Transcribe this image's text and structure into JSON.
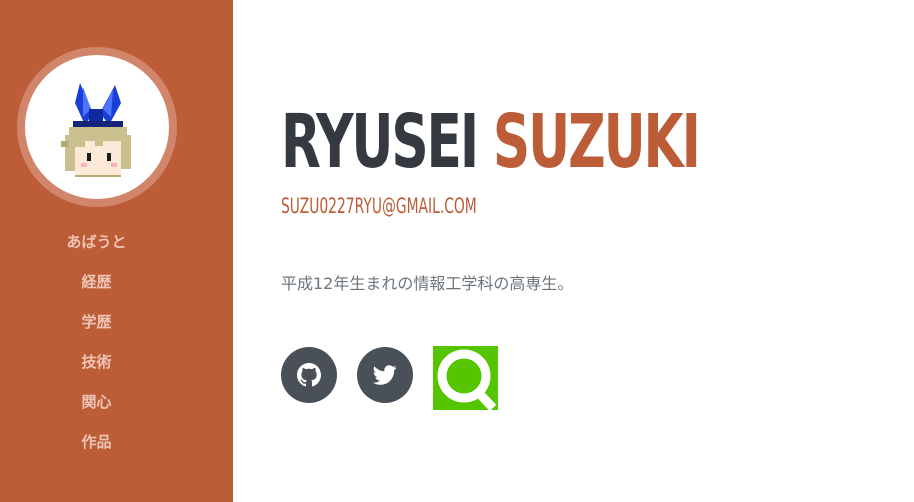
{
  "sidebar": {
    "background": "#bd5d38",
    "nav_items": [
      {
        "label": "あばうと"
      },
      {
        "label": "経歴"
      },
      {
        "label": "学歴"
      },
      {
        "label": "技術"
      },
      {
        "label": "関心"
      },
      {
        "label": "作品"
      }
    ]
  },
  "profile": {
    "first_name": "RYUSEI",
    "last_name": "SUZUKI",
    "email": "SUZU0227RYU@GMAIL.COM",
    "bio": "平成12年生まれの情報工学科の高専生。",
    "accent_color": "#bd5d38"
  },
  "social": [
    {
      "name": "github",
      "icon": "github-icon"
    },
    {
      "name": "twitter",
      "icon": "twitter-icon"
    },
    {
      "name": "qiita",
      "icon": "qiita-icon",
      "color": "#55c500"
    }
  ]
}
